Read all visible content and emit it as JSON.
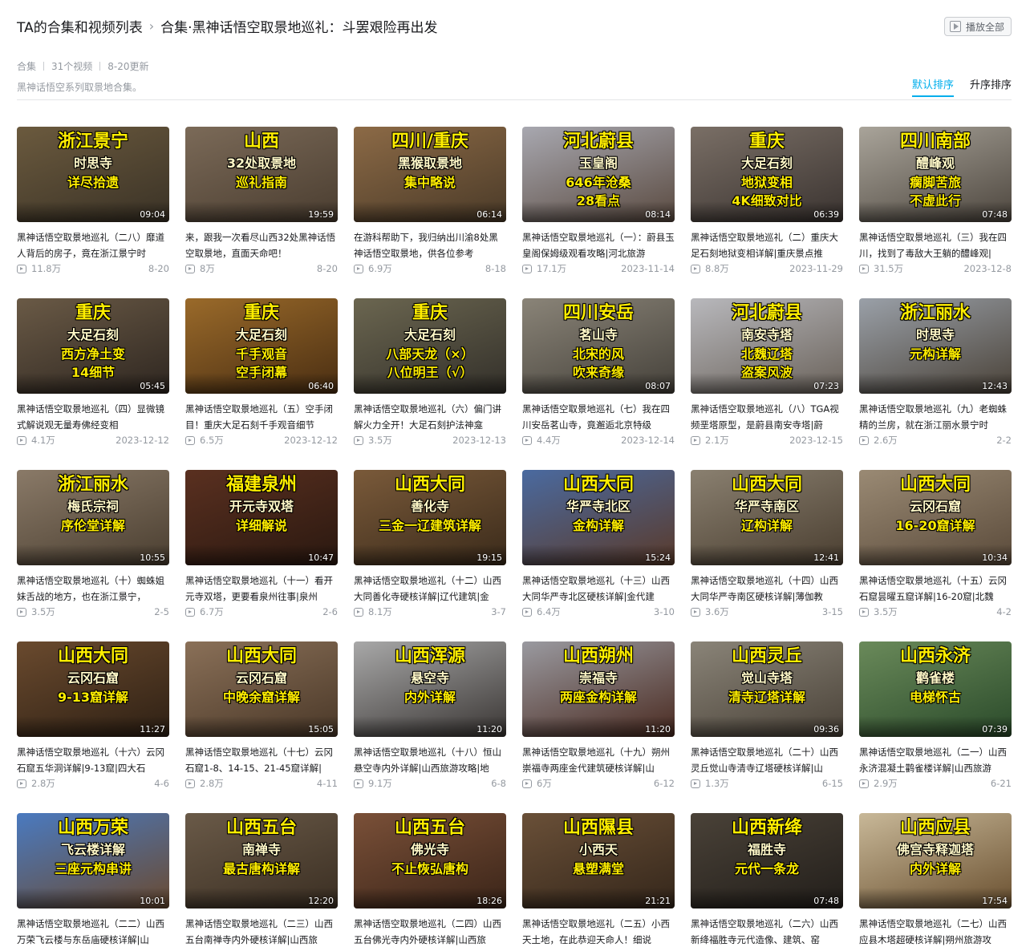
{
  "breadcrumb": {
    "parent": "TA的合集和视频列表",
    "separator": "›",
    "current": "合集·黑神话悟空取景地巡礼：斗罢艰险再出发"
  },
  "play_all_label": "播放全部",
  "meta": {
    "type": "合集",
    "count": "31个视频",
    "updated": "8-20更新"
  },
  "description": "黑神话悟空系列取景地合集。",
  "sort": {
    "default": "默认排序",
    "ascending": "升序排序",
    "active": "default"
  },
  "videos": [
    {
      "cap": [
        "浙江景宁",
        "时思寺",
        "详尽拾遗",
        ""
      ],
      "duration": "09:04",
      "title": "黑神话悟空取景地巡礼（二八）靡道人背后的房子，竟在浙江景宁时",
      "views": "11.8万",
      "date": "8-20",
      "bg": [
        "#6b5a3e",
        "#3a3226"
      ]
    },
    {
      "cap": [
        "山西",
        "32处取景地",
        "巡礼指南",
        ""
      ],
      "duration": "19:59",
      "title": "来，跟我一次看尽山西32处黑神话悟空取景地，直面天命吧！",
      "views": "8万",
      "date": "8-20",
      "bg": [
        "#7b6a58",
        "#4a3d30"
      ]
    },
    {
      "cap": [
        "四川/重庆",
        "黑猴取景地",
        "集中略说",
        ""
      ],
      "duration": "06:14",
      "title": "在游科帮助下，我归纳出川渝8处黑神话悟空取景地，供各位参考",
      "views": "6.9万",
      "date": "8-18",
      "bg": [
        "#8c6a46",
        "#4a3a28"
      ]
    },
    {
      "cap": [
        "河北蔚县",
        "玉皇阁",
        "646年沧桑",
        "28看点"
      ],
      "duration": "08:14",
      "title": "黑神话悟空取景地巡礼（一）：蔚县玉皇阁保姆级观看攻略|河北旅游",
      "views": "17.1万",
      "date": "2023-11-14",
      "bg": [
        "#a8a8b0",
        "#5a4a40"
      ]
    },
    {
      "cap": [
        "重庆",
        "大足石刻",
        "地狱变相",
        "4K细致对比"
      ],
      "duration": "06:39",
      "title": "黑神话悟空取景地巡礼（二）重庆大足石刻地狱变相详解|重庆景点推",
      "views": "8.8万",
      "date": "2023-11-29",
      "bg": [
        "#7a6f66",
        "#3a3330"
      ]
    },
    {
      "cap": [
        "四川南部",
        "醴峰观",
        "瘸脚苦旅",
        "不虚此行"
      ],
      "duration": "07:48",
      "title": "黑神话悟空取景地巡礼（三）我在四川，找到了毒敌大王躺的醴峰观|",
      "views": "31.5万",
      "date": "2023-12-8",
      "bg": [
        "#a9a49a",
        "#4d463e"
      ]
    },
    {
      "cap": [
        "重庆",
        "大足石刻",
        "西方净土变",
        "14细节"
      ],
      "duration": "05:45",
      "title": "黑神话悟空取景地巡礼（四）显微镜式解说观无量寿佛经变相",
      "views": "4.1万",
      "date": "2023-12-12",
      "bg": [
        "#6a5a46",
        "#2e2620"
      ]
    },
    {
      "cap": [
        "重庆",
        "大足石刻",
        "千手观音",
        "空手闭幕"
      ],
      "duration": "06:40",
      "title": "黑神话悟空取景地巡礼（五）空手闭目！重庆大足石刻千手观音细节",
      "views": "6.5万",
      "date": "2023-12-12",
      "bg": [
        "#9a6a2a",
        "#4a2e12"
      ]
    },
    {
      "cap": [
        "重庆",
        "大足石刻",
        "八部天龙（×）",
        "八位明王（√）"
      ],
      "duration": "",
      "title": "黑神话悟空取景地巡礼（六）偏门讲解火力全开！大足石刻护法神龛",
      "views": "3.5万",
      "date": "2023-12-13",
      "bg": [
        "#6b6650",
        "#33302a"
      ]
    },
    {
      "cap": [
        "四川安岳",
        "茗山寺",
        "北宋的风",
        "吹来奇缘"
      ],
      "duration": "08:07",
      "title": "黑神话悟空取景地巡礼（七）我在四川安岳茗山寺，竟邂逅北京特级",
      "views": "4.4万",
      "date": "2023-12-14",
      "bg": [
        "#8a8478",
        "#45413a"
      ]
    },
    {
      "cap": [
        "河北蔚县",
        "南安寺塔",
        "北魏辽塔",
        "盗案风波"
      ],
      "duration": "07:23",
      "title": "黑神话悟空取景地巡礼（八）TGA视频垩塔原型，是蔚县南安寺塔|蔚",
      "views": "2.1万",
      "date": "2023-12-15",
      "bg": [
        "#b8b8bc",
        "#6a625a"
      ]
    },
    {
      "cap": [
        "浙江丽水",
        "时思寺",
        "元构详解",
        ""
      ],
      "duration": "12:43",
      "title": "黑神话悟空取景地巡礼（九）老蜘蛛精的兰房，就在浙江丽水景宁时",
      "views": "2.6万",
      "date": "2-2",
      "bg": [
        "#9aa0a8",
        "#4a4238"
      ]
    },
    {
      "cap": [
        "浙江丽水",
        "梅氏宗祠",
        "序伦堂详解",
        ""
      ],
      "duration": "10:55",
      "title": "黑神话悟空取景地巡礼（十）蜘蛛姐妹舌战的地方，也在浙江景宁，",
      "views": "3.5万",
      "date": "2-5",
      "bg": [
        "#8a7a68",
        "#4a3e30"
      ]
    },
    {
      "cap": [
        "福建泉州",
        "开元寺双塔",
        "详细解说",
        ""
      ],
      "duration": "10:47",
      "title": "黑神话悟空取景地巡礼（十一）看开元寺双塔，更要看泉州往事|泉州",
      "views": "6.7万",
      "date": "2-6",
      "bg": [
        "#5a3020",
        "#2a1810"
      ]
    },
    {
      "cap": [
        "山西大同",
        "善化寺",
        "三金一辽建筑详解",
        ""
      ],
      "duration": "19:15",
      "title": "黑神话悟空取景地巡礼（十二）山西大同善化寺硬核详解|辽代建筑|金",
      "views": "8.1万",
      "date": "3-7",
      "bg": [
        "#7a5a3a",
        "#3a2a1a"
      ]
    },
    {
      "cap": [
        "山西大同",
        "华严寺北区",
        "金构详解",
        ""
      ],
      "duration": "15:24",
      "title": "黑神话悟空取景地巡礼（十三）山西大同华严寺北区硬核详解|金代建",
      "views": "6.4万",
      "date": "3-10",
      "bg": [
        "#4a6aa0",
        "#5a3a2a"
      ]
    },
    {
      "cap": [
        "山西大同",
        "华严寺南区",
        "辽构详解",
        ""
      ],
      "duration": "12:41",
      "title": "黑神话悟空取景地巡礼（十四）山西大同华严寺南区硬核详解|薄伽教",
      "views": "3.6万",
      "date": "3-15",
      "bg": [
        "#8a8070",
        "#4a3e30"
      ]
    },
    {
      "cap": [
        "山西大同",
        "云冈石窟",
        "16-20窟详解",
        ""
      ],
      "duration": "10:34",
      "title": "黑神话悟空取景地巡礼（十五）云冈石窟昙曜五窟详解|16-20窟|北魏",
      "views": "3.5万",
      "date": "4-2",
      "bg": [
        "#9a8a74",
        "#5a4a3a"
      ]
    },
    {
      "cap": [
        "山西大同",
        "云冈石窟",
        "9-13窟详解",
        ""
      ],
      "duration": "11:27",
      "title": "黑神话悟空取景地巡礼（十六）云冈石窟五华洞详解|9-13窟|四大石",
      "views": "2.8万",
      "date": "4-6",
      "bg": [
        "#6a4a2e",
        "#2e2014"
      ]
    },
    {
      "cap": [
        "山西大同",
        "云冈石窟",
        "中晚余窟详解",
        ""
      ],
      "duration": "15:05",
      "title": "黑神话悟空取景地巡礼（十七）云冈石窟1-8、14-15、21-45窟详解|",
      "views": "2.8万",
      "date": "4-11",
      "bg": [
        "#8a7058",
        "#4a3828"
      ]
    },
    {
      "cap": [
        "山西浑源",
        "悬空寺",
        "内外详解",
        ""
      ],
      "duration": "11:20",
      "title": "黑神话悟空取景地巡礼（十八）恒山悬空寺内外详解|山西旅游攻略|地",
      "views": "9.1万",
      "date": "6-8",
      "bg": [
        "#a8a8a8",
        "#3a3634"
      ]
    },
    {
      "cap": [
        "山西朔州",
        "崇福寺",
        "两座金构详解",
        ""
      ],
      "duration": "11:20",
      "title": "黑神话悟空取景地巡礼（十九）朔州崇福寺两座金代建筑硬核详解|山",
      "views": "6万",
      "date": "6-12",
      "bg": [
        "#9a9aa0",
        "#4a2a20"
      ]
    },
    {
      "cap": [
        "山西灵丘",
        "觉山寺塔",
        "清寺辽塔详解",
        ""
      ],
      "duration": "09:36",
      "title": "黑神话悟空取景地巡礼（二十）山西灵丘觉山寺清寺辽塔硬核详解|山",
      "views": "1.3万",
      "date": "6-15",
      "bg": [
        "#8a8478",
        "#4a4238"
      ]
    },
    {
      "cap": [
        "山西永济",
        "鹳雀楼",
        "电梯怀古",
        ""
      ],
      "duration": "07:39",
      "title": "黑神话悟空取景地巡礼（二一）山西永济混凝土鹳雀楼详解|山西旅游",
      "views": "2.9万",
      "date": "6-21",
      "bg": [
        "#6a8a5a",
        "#2a4a2a"
      ]
    },
    {
      "cap": [
        "山西万荣",
        "飞云楼详解",
        "三座元构串讲",
        ""
      ],
      "duration": "10:01",
      "title": "黑神话悟空取景地巡礼（二二）山西万荣飞云楼与东岳庙硬核详解|山",
      "views": "",
      "date": "",
      "bg": [
        "#4a7ac0",
        "#6a4a30"
      ]
    },
    {
      "cap": [
        "山西五台",
        "南禅寺",
        "最古唐构详解",
        ""
      ],
      "duration": "12:20",
      "title": "黑神话悟空取景地巡礼（二三）山西五台南禅寺内外硬核详解|山西旅",
      "views": "",
      "date": "",
      "bg": [
        "#6a5a48",
        "#3a2e22"
      ]
    },
    {
      "cap": [
        "山西五台",
        "佛光寺",
        "不止恢弘唐构",
        ""
      ],
      "duration": "18:26",
      "title": "黑神话悟空取景地巡礼（二四）山西五台佛光寺内外硬核详解|山西旅",
      "views": "",
      "date": "",
      "bg": [
        "#7a5038",
        "#3a2418"
      ]
    },
    {
      "cap": [
        "山西隰县",
        "小西天",
        "悬塑满堂",
        ""
      ],
      "duration": "21:21",
      "title": "黑神话悟空取景地巡礼（二五）小西天土地，在此恭迎天命人！细说",
      "views": "",
      "date": "",
      "bg": [
        "#6a5038",
        "#34261a"
      ]
    },
    {
      "cap": [
        "山西新绛",
        "福胜寺",
        "元代一条龙",
        ""
      ],
      "duration": "07:48",
      "title": "黑神话悟空取景地巡礼（二六）山西新绛福胜寺元代造像、建筑、窑",
      "views": "",
      "date": "",
      "bg": [
        "#4a4238",
        "#221e1a"
      ]
    },
    {
      "cap": [
        "山西应县",
        "佛宫寺释迦塔",
        "内外详解",
        ""
      ],
      "duration": "17:54",
      "title": "黑神话悟空取景地巡礼（二七）山西应县木塔超硬核详解|朔州旅游攻",
      "views": "",
      "date": "",
      "bg": [
        "#c8b898",
        "#6a5030"
      ]
    }
  ]
}
